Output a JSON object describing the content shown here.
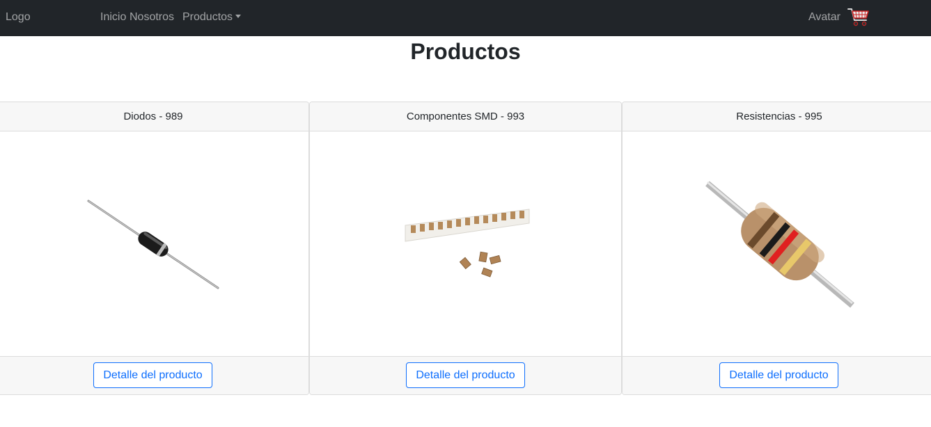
{
  "navbar": {
    "logo": "Logo",
    "links": {
      "inicio": "Inicio",
      "nosotros": "Nosotros",
      "productos": "Productos"
    },
    "avatar": "Avatar",
    "cart_icon": "shopping-cart-icon"
  },
  "page": {
    "title": "Productos"
  },
  "products": [
    {
      "header": "Diodos - 989",
      "image": "diode-image",
      "button": "Detalle del producto"
    },
    {
      "header": "Componentes SMD - 993",
      "image": "smd-components-image",
      "button": "Detalle del producto"
    },
    {
      "header": "Resistencias - 995",
      "image": "resistor-image",
      "button": "Detalle del producto"
    }
  ],
  "colors": {
    "navbar_bg": "#212529",
    "nav_text": "rgba(255,255,255,0.55)",
    "accent": "#0d6efd",
    "card_header_bg": "#f7f7f7"
  }
}
